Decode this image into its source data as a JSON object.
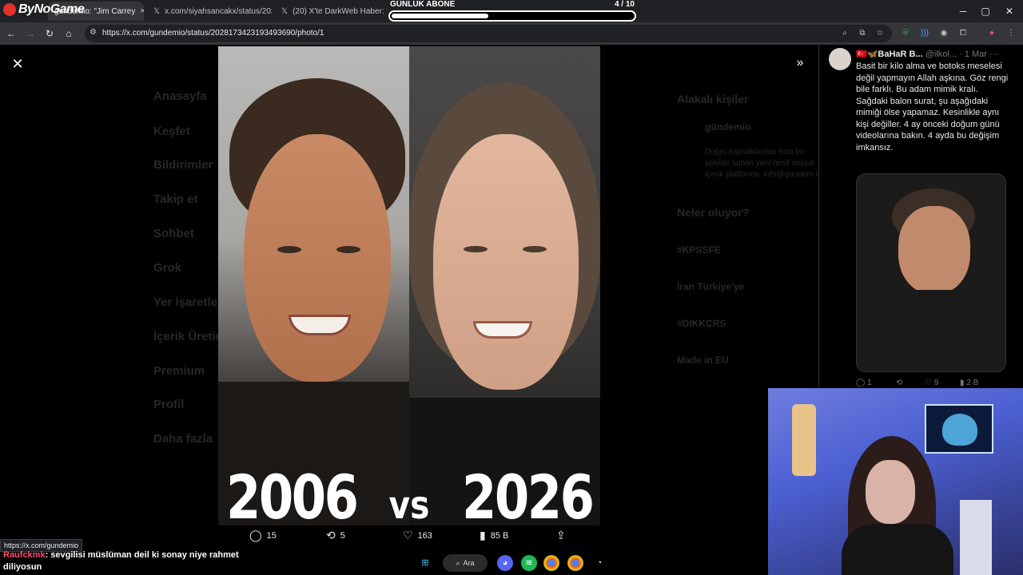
{
  "browser": {
    "brand": "ByNoGame",
    "tabs": [
      {
        "title": "gundemio: \"Jim Carrey",
        "close": "×"
      },
      {
        "title": "x.com/siyahsancakx/status/202",
        "close": "×"
      },
      {
        "title": "(20) X'te DarkWeb Haber: \"AK P",
        "close": "×"
      }
    ],
    "url": "https://x.com/gundemio/status/2028173423193493690/photo/1",
    "window_controls": [
      "─",
      "▢",
      "✕"
    ]
  },
  "subscriber_goal": {
    "label": "GÜNLÜK ABONE",
    "count": "4   / 10",
    "progress": 0.4
  },
  "x_nav_dimmed": [
    "Anasayfa",
    "Keşfet",
    "Bildirimler",
    "Takip et",
    "Sohbet",
    "Grok",
    "Yer İşaretleri",
    "İçerik Üreticisi",
    "Premium",
    "Profil",
    "Daha fazla"
  ],
  "x_right_dimmed": {
    "section_related": "Alakalı kişiler",
    "account_name": "gündemio",
    "account_desc": "Doğru kaynaklardan hızlı bir şekilde sunan yeni nesil sosyal içerik platformu. info@gundem.io",
    "section_trends": "Neler oluyor?",
    "trends": [
      "#KPSSFE",
      "İran Türkiye'ye",
      "#DIKKÇRS",
      "Made in EU"
    ]
  },
  "photo": {
    "caption_left": "2006",
    "caption_mid": "vs",
    "caption_right": "2026"
  },
  "actions": {
    "replies": "15",
    "retweets": "5",
    "likes": "163",
    "views": "85 B"
  },
  "reply": {
    "name": "🇹🇷🦋BaHaR B...",
    "handle": "@ilkol...",
    "date": "· 1 Mar",
    "more": "···",
    "text": "Basit bir kilo alma ve botoks meselesi değil yapmayın Allah aşkına. Göz rengi bile farklı. Bu adam mimik kralı.\nSağdaki balon surat, şu aşağıdaki mimiği ölse yapamaz. Kesinlikle aynı kişi değiller. 4 ay önceki doğum günü videolarına bakın. 4 ayda bu değişim imkansız.",
    "stats": {
      "replies": "1",
      "likes": "9",
      "views": "2 B"
    }
  },
  "status_url": "https://x.com/gundemio",
  "chat": {
    "user": "Raufckmk",
    "message": ": sevgilisi müslüman deil ki sonay niye rahmet diliyosun"
  },
  "taskbar": {
    "search_label": "Ara"
  },
  "colors": {
    "accent_red": "#ff4d6d",
    "chrome_dark": "#202124",
    "chrome_toolbar": "#35363a"
  }
}
